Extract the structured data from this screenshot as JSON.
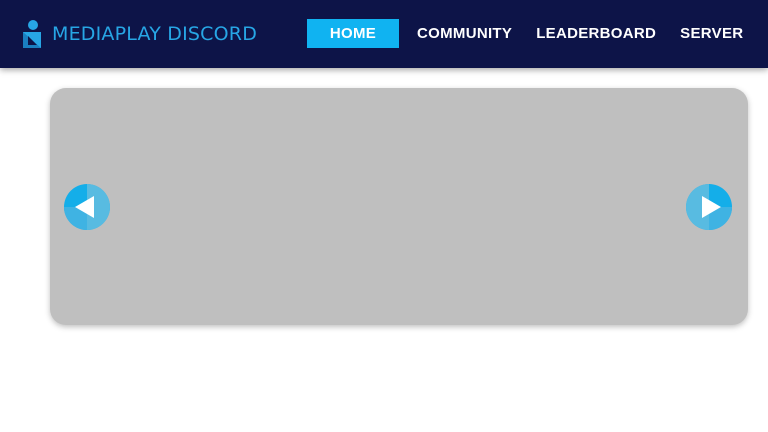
{
  "brand": {
    "name_part1": "MEDIAPLAY",
    "name_part2": " DISCORD",
    "color": "#27a6e5"
  },
  "nav": {
    "items": [
      {
        "label": "HOME",
        "active": true
      },
      {
        "label": "COMMUNITY",
        "active": false
      },
      {
        "label": "LEADERBOARD",
        "active": false
      },
      {
        "label": "SERVER",
        "active": false
      }
    ],
    "active_color": "#10b3f1",
    "bar_color": "#0d1448"
  },
  "slider": {
    "background": "#bfbfbf",
    "prev_icon": "arrow-left-icon",
    "next_icon": "arrow-right-icon"
  }
}
